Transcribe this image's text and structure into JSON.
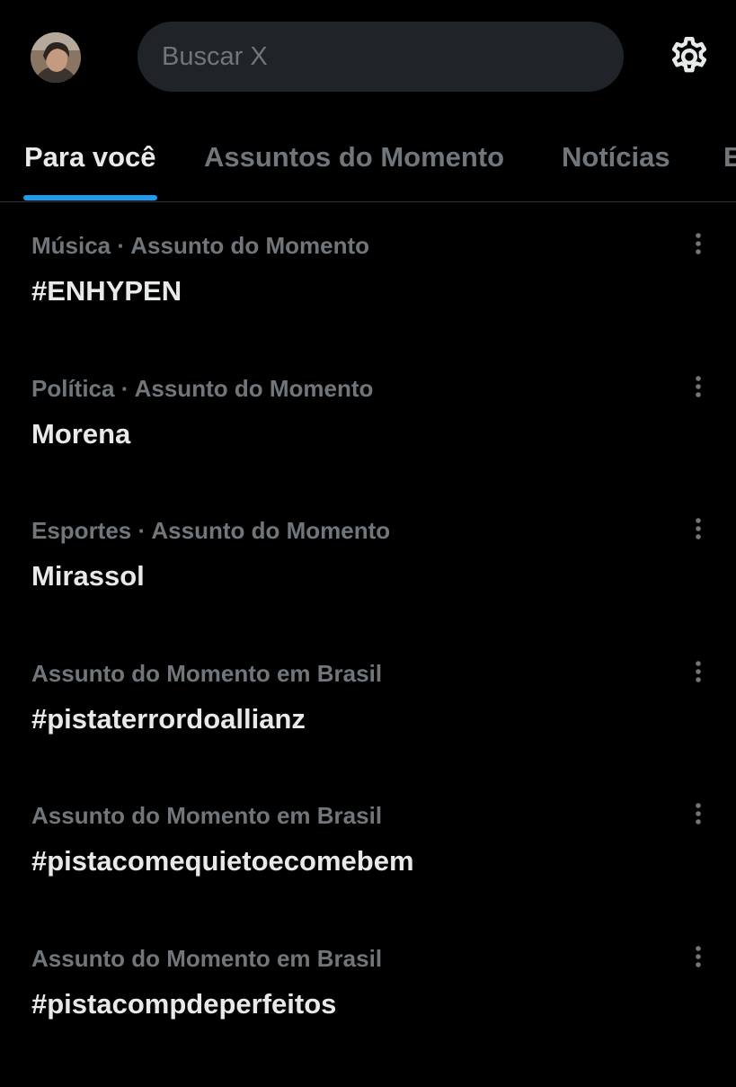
{
  "header": {
    "search_placeholder": "Buscar X"
  },
  "tabs": [
    {
      "label": "Para você",
      "active": true
    },
    {
      "label": "Assuntos do Momento",
      "active": false
    },
    {
      "label": "Notícias",
      "active": false
    },
    {
      "label": "E",
      "active": false
    }
  ],
  "trends": [
    {
      "context": "Música · Assunto do Momento",
      "name": "#ENHYPEN"
    },
    {
      "context": "Política · Assunto do Momento",
      "name": "Morena"
    },
    {
      "context": "Esportes · Assunto do Momento",
      "name": "Mirassol"
    },
    {
      "context": "Assunto do Momento em Brasil",
      "name": "#pistaterrordoallianz"
    },
    {
      "context": "Assunto do Momento em Brasil",
      "name": "#pistacomequietoecomebem"
    },
    {
      "context": "Assunto do Momento em Brasil",
      "name": "#pistacompdeperfeitos"
    }
  ],
  "colors": {
    "background": "#000000",
    "primary_text": "#e7e9ea",
    "secondary_text": "#71767b",
    "accent": "#1d9bf0",
    "search_bg": "#202327",
    "divider": "#2f3336"
  },
  "icons": {
    "avatar": "profile-avatar",
    "settings": "gear-icon",
    "more": "more-vertical-icon"
  }
}
